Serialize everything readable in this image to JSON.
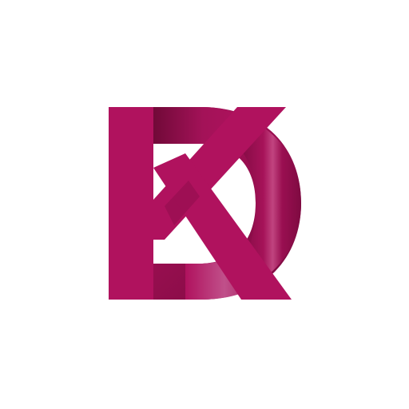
{
  "logo": {
    "letters": "DK",
    "colors": {
      "primary": "#b0125e",
      "dark": "#7d0a40",
      "shade": "#8f0d4c",
      "highlight": "#c64a85",
      "background": "#ffffff"
    }
  }
}
